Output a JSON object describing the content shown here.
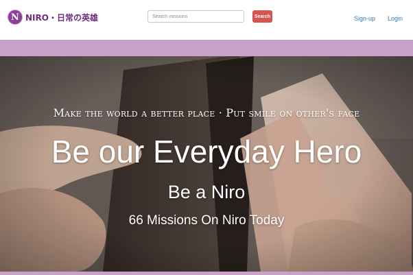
{
  "brand": {
    "logo_letter": "N",
    "name": "NIRO・日常の英雄"
  },
  "search": {
    "placeholder": "Search missions",
    "value": "",
    "button_label": "Search"
  },
  "nav": {
    "signup_label": "Sign-up",
    "login_label": "Login"
  },
  "hero": {
    "tagline": "Make the world a better place · Put smile on other's face",
    "title": "Be our Everyday Hero",
    "subtitle": "Be a Niro",
    "missions_text": "66 Missions On Niro Today",
    "image_subject": "hands-opening-wallet-with-banknotes"
  },
  "colors": {
    "brand": "#6e2e7c",
    "band": "#c9a0c6",
    "search_button": "#d9534f",
    "link": "#337ab7"
  }
}
